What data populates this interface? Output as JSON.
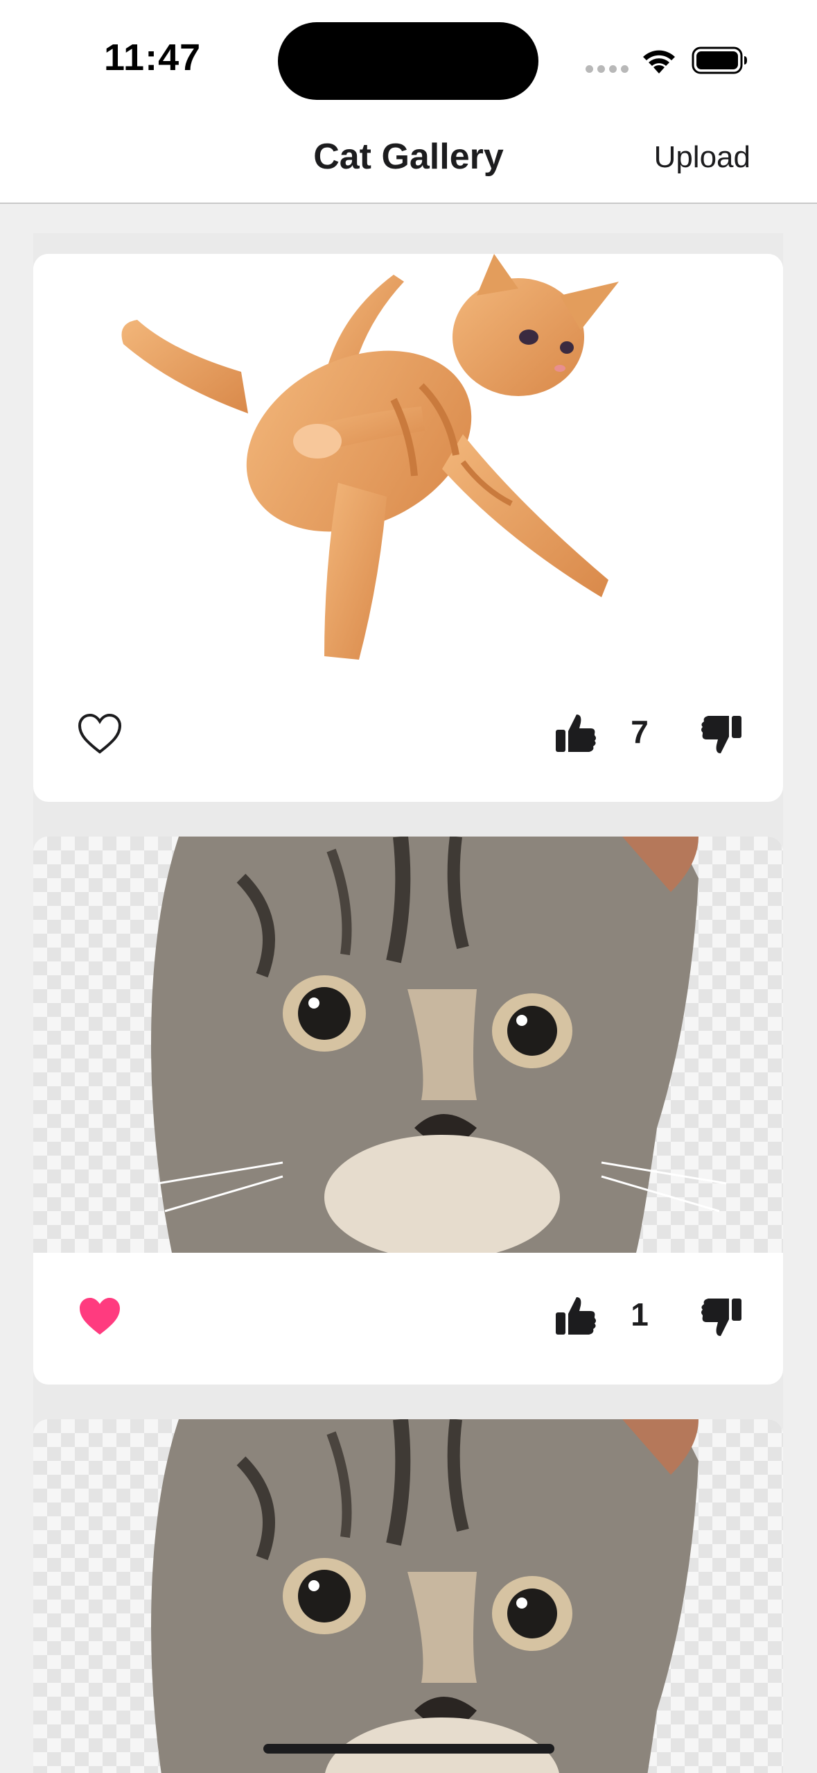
{
  "status_bar": {
    "time": "11:47"
  },
  "nav": {
    "title": "Cat Gallery",
    "upload_label": "Upload"
  },
  "cards": [
    {
      "image": "orange-tabby-cat-leaping",
      "favourite": false,
      "votes": "7"
    },
    {
      "image": "grey-tabby-kitten-face",
      "favourite": true,
      "votes": "1"
    },
    {
      "image": "grey-tabby-kitten-face"
    }
  ],
  "colors": {
    "favourite_active": "#ff3b7f",
    "icon": "#1c1c1e",
    "background": "#efefef",
    "card": "#ffffff"
  },
  "icons": {
    "favourite_inactive": "heart-outline-icon",
    "favourite_active": "heart-filled-icon",
    "vote_up": "thumbs-up-icon",
    "vote_down": "thumbs-down-icon"
  }
}
